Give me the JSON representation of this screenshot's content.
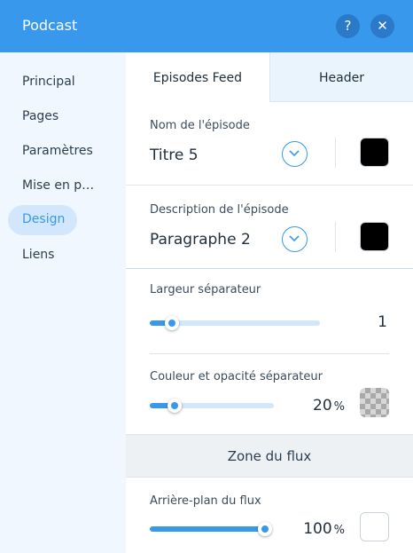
{
  "header": {
    "title": "Podcast",
    "help_label": "?",
    "close_label": "✕"
  },
  "sidebar": {
    "items": [
      {
        "label": "Principal"
      },
      {
        "label": "Pages"
      },
      {
        "label": "Paramètres"
      },
      {
        "label": "Mise en p…"
      },
      {
        "label": "Design",
        "active": true
      },
      {
        "label": "Liens"
      }
    ]
  },
  "tabs": [
    {
      "label": "Episodes Feed",
      "active": true
    },
    {
      "label": "Header",
      "active": false
    }
  ],
  "episode_name": {
    "label": "Nom de l'épisode",
    "font_value": "Titre 5",
    "color": "#000000"
  },
  "episode_description": {
    "label": "Description de l'épisode",
    "font_value": "Paragraphe 2",
    "color": "#000000"
  },
  "separator_width": {
    "label": "Largeur séparateur",
    "value": "1",
    "level": 0.13
  },
  "separator_color": {
    "label": "Couleur et opacité séparateur",
    "value": "20",
    "unit": "%",
    "level": 0.2
  },
  "feed_zone": {
    "title": "Zone du flux"
  },
  "feed_background": {
    "label": "Arrière-plan du flux",
    "value": "100",
    "unit": "%",
    "level": 1.0,
    "color": "#ffffff"
  },
  "colors": {
    "accent": "#3899ec",
    "header_bg": "#3899ec",
    "sidebar_bg": "#f0f7fe",
    "active_pill": "#d3e7fc"
  }
}
